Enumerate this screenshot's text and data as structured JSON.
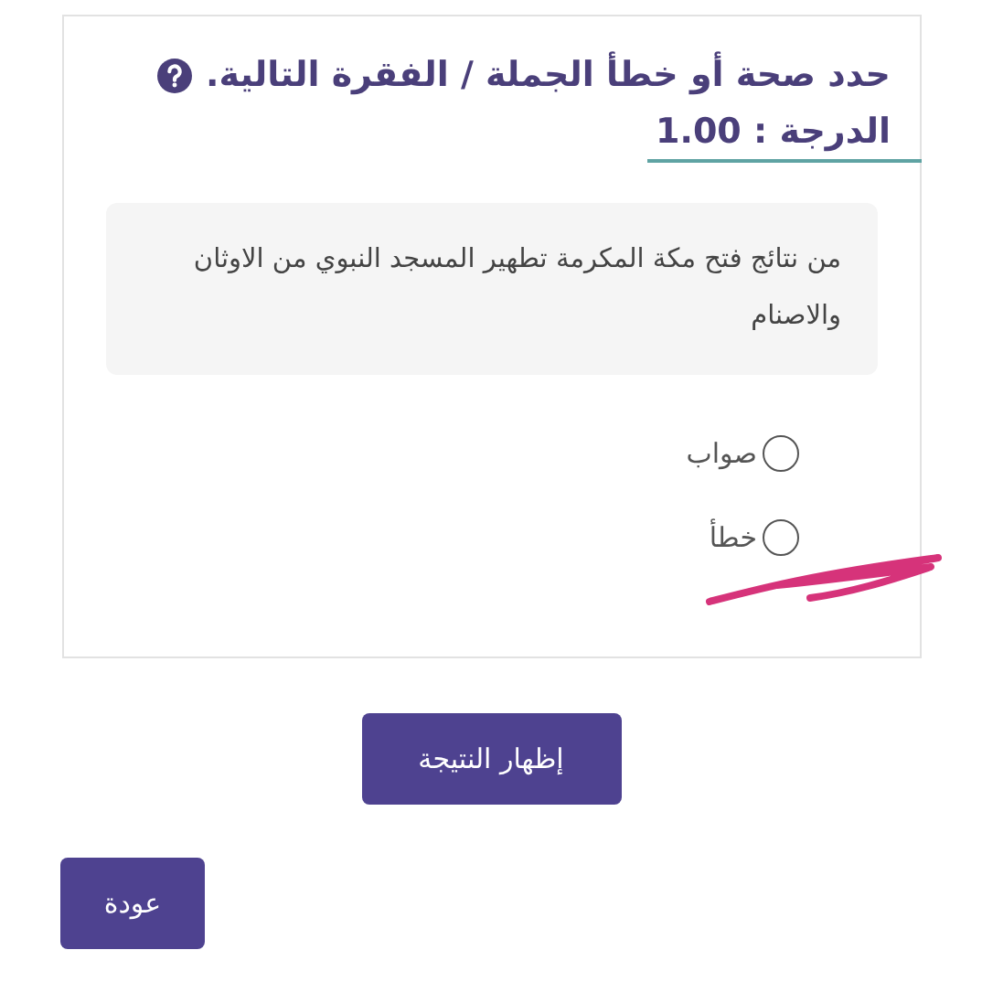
{
  "question": {
    "title": "حدد صحة أو خطأ الجملة / الفقرة التالية.",
    "grade": "الدرجة : 1.00",
    "text": "من نتائج فتح مكة المكرمة تطهير المسجد النبوي من الاوثان والاصنام"
  },
  "options": [
    {
      "label": "صواب",
      "selected": false
    },
    {
      "label": "خطأ",
      "selected": false
    }
  ],
  "buttons": {
    "show_result": "إظهار النتيجة",
    "back": "عودة"
  }
}
